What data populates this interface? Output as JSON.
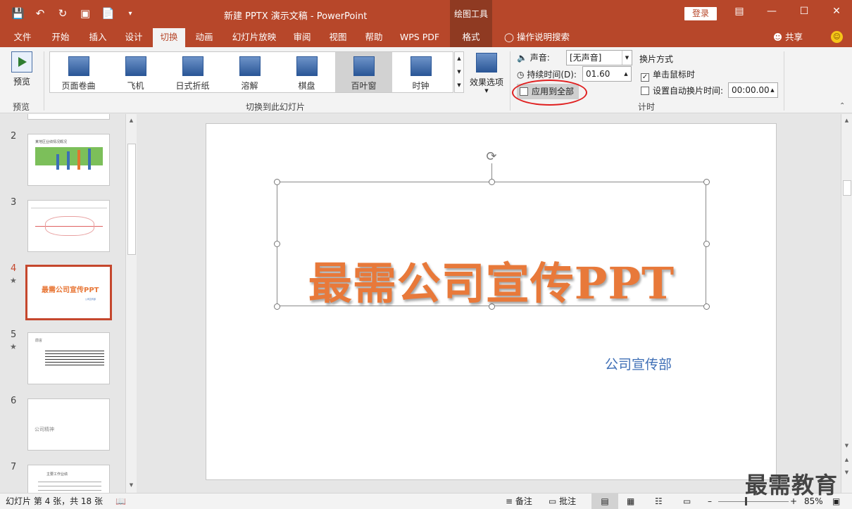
{
  "titlebar": {
    "save_icon": "save-icon",
    "undo_icon": "undo-icon",
    "redo_icon": "redo-icon",
    "present_icon": "present-icon",
    "new_icon": "new-file-icon",
    "customize_icon": "customize-qat-icon",
    "title": "新建 PPTX 演示文稿  -  PowerPoint",
    "context_tab": "绘图工具",
    "login": "登录"
  },
  "tabs": [
    "文件",
    "开始",
    "插入",
    "设计",
    "切换",
    "动画",
    "幻灯片放映",
    "审阅",
    "视图",
    "帮助",
    "WPS PDF"
  ],
  "active_tab": "切换",
  "format_tab": "格式",
  "tell_me": "操作说明搜索",
  "share": "共享",
  "ribbon": {
    "preview_label": "预览",
    "preview_group": "预览",
    "gallery_group": "切换到此幻灯片",
    "transitions": [
      {
        "label": "页面卷曲",
        "selected": false
      },
      {
        "label": "飞机",
        "selected": false
      },
      {
        "label": "日式折纸",
        "selected": false
      },
      {
        "label": "溶解",
        "selected": false
      },
      {
        "label": "棋盘",
        "selected": false
      },
      {
        "label": "百叶窗",
        "selected": true
      },
      {
        "label": "时钟",
        "selected": false
      }
    ],
    "effect_options": "效果选项",
    "sound_label": "声音:",
    "sound_value": "[无声音]",
    "duration_label": "持续时间(D):",
    "duration_value": "01.60",
    "apply_all": "应用到全部",
    "advance_title": "换片方式",
    "on_click_label": "单击鼠标时",
    "on_click_checked": true,
    "after_label": "设置自动换片时间:",
    "after_value": "00:00.00",
    "timing_group": "计时"
  },
  "thumbnails": [
    {
      "num": "2",
      "star": false,
      "title": "某地区业绩情况概况"
    },
    {
      "num": "3",
      "star": false,
      "title": ""
    },
    {
      "num": "4",
      "star": true,
      "title": "最需公司宣传PPT",
      "sub": "公司宣传部"
    },
    {
      "num": "5",
      "star": true,
      "title": "前言"
    },
    {
      "num": "6",
      "star": false,
      "title": "公司精神"
    },
    {
      "num": "7",
      "star": false,
      "title": "主要工作业绩"
    }
  ],
  "slide": {
    "title": "最需公司宣传PPT",
    "subtitle": "公司宣传部"
  },
  "status": {
    "slide_info": "幻灯片 第 4 张，共 18 张",
    "notes": "备注",
    "comments": "批注",
    "zoom": "85%"
  },
  "watermark": "最需教育"
}
